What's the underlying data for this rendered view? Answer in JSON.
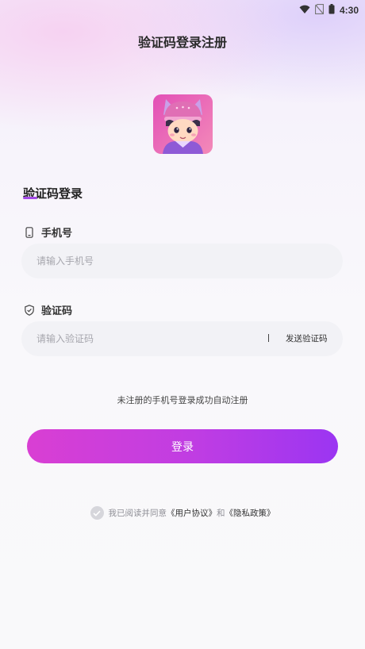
{
  "status_bar": {
    "time": "4:30"
  },
  "header": {
    "title": "验证码登录注册"
  },
  "login": {
    "section_title": "验证码登录",
    "phone": {
      "label": "手机号",
      "placeholder": "请输入手机号",
      "value": ""
    },
    "code": {
      "label": "验证码",
      "placeholder": "请输入验证码",
      "value": "",
      "send_label": "发送验证码"
    },
    "register_hint": "未注册的手机号登录成功自动注册",
    "submit_label": "登录"
  },
  "agreement": {
    "checked": true,
    "prefix": "我已阅读并同意",
    "user_agreement": "《用户协议》",
    "and": "和",
    "privacy_policy": "《隐私政策》"
  },
  "colors": {
    "accent": "#a44be8",
    "button_start": "#d93fd3",
    "button_end": "#9b35f2"
  }
}
